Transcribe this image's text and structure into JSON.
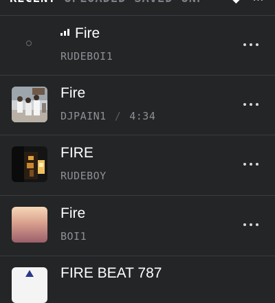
{
  "tabs": {
    "items": [
      {
        "label": "RECENT",
        "active": true
      },
      {
        "label": "UPLOADED",
        "active": false
      },
      {
        "label": "SAVED",
        "active": false
      },
      {
        "label": "UNP",
        "active": false
      }
    ],
    "sort_icon": "sort-arrow-icon",
    "more_icon": "more-icon"
  },
  "tracks": [
    {
      "title": "Fire",
      "artist": "RUDEBOI1",
      "duration": "",
      "playing": true,
      "thumb": "empty"
    },
    {
      "title": "Fire",
      "artist": "DJPAIN1",
      "duration": "4:34",
      "playing": false,
      "thumb": "people"
    },
    {
      "title": "FIRE",
      "artist": "RUDEBOY",
      "duration": "",
      "playing": false,
      "thumb": "dark-fire"
    },
    {
      "title": "Fire",
      "artist": "BOI1",
      "duration": "",
      "playing": false,
      "thumb": "gradient"
    },
    {
      "title": "FIRE BEAT 787",
      "artist": "",
      "duration": "",
      "playing": false,
      "thumb": "triangle"
    }
  ],
  "colors": {
    "background": "#232527",
    "text": "#ffffff",
    "muted": "#8e9195"
  }
}
